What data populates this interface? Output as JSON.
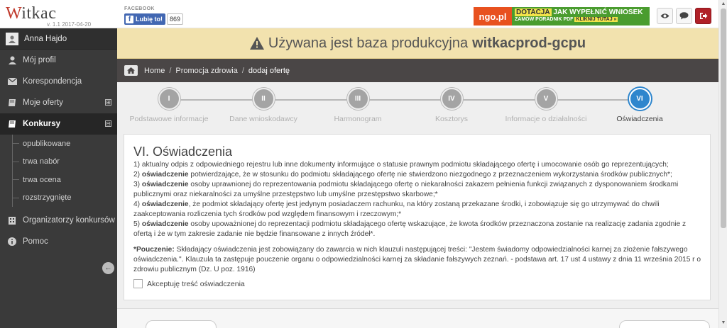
{
  "app": {
    "logo_w": "W",
    "logo_rest": "itkac",
    "version": "v. 1.1 2017-04-20"
  },
  "facebook": {
    "caption": "FACEBOOK",
    "like_label": "Lubię to!",
    "like_count": "869"
  },
  "banner": {
    "ngo": "ngo.pl",
    "line1_highlight": "DOTACJA",
    "line1_rest": "JAK WYPEŁNIĆ WNIOSEK",
    "line2_rest": "ZAMÓW PORADNIK PDF",
    "line2_highlight": "KLIKNIJ TUTAJ »"
  },
  "user": {
    "name": "Anna Hajdo"
  },
  "sidebar": {
    "items": [
      {
        "label": "Mój profil",
        "icon": "user-icon"
      },
      {
        "label": "Korespondencja",
        "icon": "envelope-icon"
      },
      {
        "label": "Moje oferty",
        "icon": "book-icon",
        "expand": "⊞"
      },
      {
        "label": "Konkursy",
        "icon": "book-icon",
        "expand": "⊟"
      },
      {
        "label": "Organizatorzy konkursów",
        "icon": "building-icon"
      },
      {
        "label": "Pomoc",
        "icon": "info-icon"
      }
    ],
    "sub_items": [
      "opublikowane",
      "trwa nabór",
      "trwa ocena",
      "rozstrzygnięte"
    ]
  },
  "notice": {
    "prefix": "Używana jest baza produkcyjna",
    "db_name": "witkacprod-gcpu"
  },
  "breadcrumb": {
    "items": [
      "Home",
      "Promocja zdrowia",
      "dodaj ofertę"
    ],
    "separator": "/"
  },
  "steps": [
    {
      "num": "I",
      "label": "Podstawowe informacje"
    },
    {
      "num": "II",
      "label": "Dane wnioskodawcy"
    },
    {
      "num": "III",
      "label": "Harmonogram"
    },
    {
      "num": "IV",
      "label": "Kosztorys"
    },
    {
      "num": "V",
      "label": "Informacje o działalności"
    },
    {
      "num": "VI",
      "label": "Oświadczenia"
    }
  ],
  "active_step": "VI",
  "section": {
    "title": "VI. Oświadczenia",
    "p1": "1) aktualny odpis z odpowiedniego rejestru lub inne dokumenty informujące o statusie prawnym podmiotu składającego ofertę i umocowanie osób go reprezentujących;",
    "p2_bold": "oświadczenie",
    "p2_pre": "2) ",
    "p2_rest": " potwierdzające, że w stosunku do podmiotu składającego ofertę nie stwierdzono niezgodnego z przeznaczeniem wykorzystania środków publicznych*;",
    "p3_pre": "3) ",
    "p3_bold": "oświadczenie",
    "p3_rest": " osoby uprawnionej do reprezentowania podmiotu składającego ofertę o niekaralności zakazem pełnienia funkcji związanych z dysponowaniem środkami publicznymi oraz niekaralności za umyślne przestępstwo lub umyślne przestępstwo skarbowe;*",
    "p4_pre": "4) ",
    "p4_bold": "oświadczenie",
    "p4_rest": ", że podmiot składający ofertę jest jedynym posiadaczem rachunku, na który zostaną przekazane środki, i zobowiązuje się go utrzymywać do chwili zaakceptowania rozliczenia tych środków pod względem finansowym i rzeczowym;*",
    "p5_pre": "5) ",
    "p5_bold": "oświadczenie",
    "p5_rest": " osoby upoważnionej do reprezentacji podmiotu składającego ofertę wskazujące, że kwota środków przeznaczona zostanie na realizację zadania zgodnie z ofertą i że w tym zakresie zadanie nie będzie finansowane z innych źródeł*.",
    "pouczenie_bold": "*Pouczenie:",
    "pouczenie_rest": " Składający oświadczenia jest zobowiązany do zawarcia w nich klauzuli następującej treści: \"Jestem świadomy odpowiedzialności karnej za złożenie fałszywego oświadczenia.\". Klauzula ta zastępuje pouczenie organu o odpowiedzialności karnej za składanie fałszywych zeznań. - podstawa art. 17 ust 4 ustawy z dnia 11 września 2015 r o zdrowiu publicznym (Dz. U poz. 1916)",
    "accept_label": "Akceptuję treść oświadczenia",
    "accept_checked": false
  },
  "colors": {
    "sidebar_bg": "#3a3a3a",
    "notice_bg": "#f2e2ae",
    "active_step": "#2e86cd",
    "ngo_orange": "#e8511f",
    "promo_green": "#4a9c2f",
    "logout_red": "#b02027"
  }
}
